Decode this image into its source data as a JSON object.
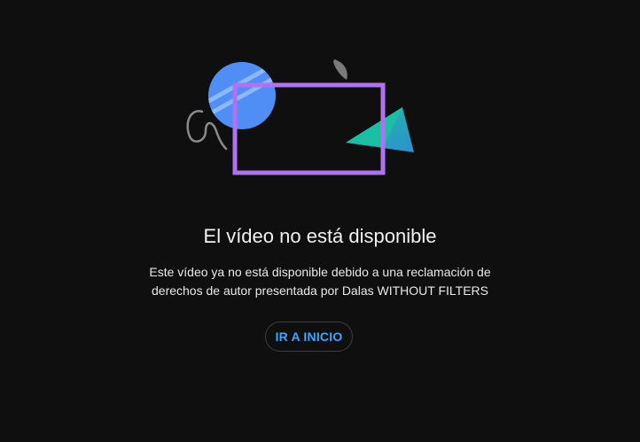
{
  "error": {
    "title": "El vídeo no está disponible",
    "message_lines": [
      "Este vídeo ya no está disponible debido a una reclamación de",
      "derechos de autor presentada por Dalas WITHOUT FILTERS"
    ]
  },
  "actions": {
    "home_label": "IR A INICIO"
  },
  "illustration": {
    "icons": [
      "blue-circle-shape",
      "purple-frame-shape",
      "teal-triangle-shape",
      "gray-half-moon-shape",
      "gray-squiggle-shape"
    ],
    "colors": {
      "circle": "#4f8ff5",
      "circle_stripes": "#8cb7f9",
      "frame": "#b072f0",
      "triangle_dark": "#2aa8b8",
      "triangle_light": "#19c3a0",
      "moon": "#7a7a7a",
      "squiggle": "#8a8a8a"
    }
  },
  "theme": {
    "background": "#0f0f0f",
    "accent": "#3ea6ff",
    "text": "#f1f1f1"
  }
}
